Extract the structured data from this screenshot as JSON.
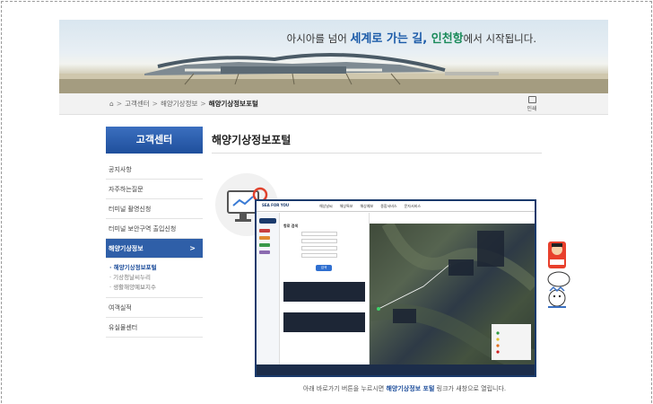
{
  "banner": {
    "slogan_pre": "아시아를 넘어 ",
    "slogan_blue": "세계로 가는 길, ",
    "slogan_green": "인천항",
    "slogan_post": "에서 시작됩니다."
  },
  "breadcrumb": {
    "home_icon": "home-icon",
    "items": [
      "고객센터",
      "해양기상정보"
    ],
    "current": "해양기상정보포털",
    "separator": ">"
  },
  "print": {
    "label": "인쇄",
    "icon": "printer-icon"
  },
  "sidebar": {
    "title": "고객센터",
    "items": [
      {
        "label": "공지사항"
      },
      {
        "label": "자주하는질문"
      },
      {
        "label": "터미널 촬영신청"
      },
      {
        "label": "터미널 보안구역 출입신청"
      },
      {
        "label": "해양기상정보",
        "arrow": ">"
      },
      {
        "label": "여객실적"
      },
      {
        "label": "유실물센터"
      }
    ],
    "sub_items": [
      {
        "label": "· 해양기상정보포털"
      },
      {
        "label": "· 기상청날씨누리"
      },
      {
        "label": "· 생활해양예보지수"
      }
    ]
  },
  "main": {
    "title": "해양기상정보포털",
    "note_pre": "아래 바로가기 버튼을 누르시면 ",
    "note_link": "해양기상정보 포털",
    "note_post": " 링크가 새창으로 열립니다."
  },
  "screenshot": {
    "logo": "SEA FOR YOU",
    "nav": [
      "해상날씨",
      "해상특보",
      "해상예보",
      "종합서비스",
      "문자서비스"
    ],
    "search_label": "항로 검색",
    "search_button": "검색"
  },
  "colors": {
    "accent": "#1f4f9c",
    "sidebar_head": "#2f5fa8",
    "slogan_blue": "#1a5aa8",
    "slogan_green": "#1a8a5a"
  }
}
